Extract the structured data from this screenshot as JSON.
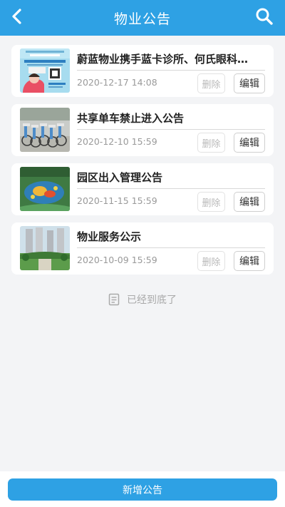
{
  "header": {
    "title": "物业公告",
    "back_icon": "chevron-left-icon",
    "search_icon": "search-icon"
  },
  "notices": [
    {
      "title": "蔚蓝物业携手蓝卡诊所、何氏眼科…",
      "date": "2020-12-17 14:08",
      "delete_label": "删除",
      "edit_label": "编辑"
    },
    {
      "title": "共享单车禁止进入公告",
      "date": "2020-12-10 15:59",
      "delete_label": "删除",
      "edit_label": "编辑"
    },
    {
      "title": "园区出入管理公告",
      "date": "2020-11-15 15:59",
      "delete_label": "删除",
      "edit_label": "编辑"
    },
    {
      "title": "物业服务公示",
      "date": "2020-10-09 15:59",
      "delete_label": "删除",
      "edit_label": "编辑"
    }
  ],
  "end_note": {
    "icon": "document-icon",
    "text": "已经到底了"
  },
  "footer": {
    "add_label": "新增公告"
  },
  "colors": {
    "accent": "#2ea1e4",
    "background": "#f3f4f6"
  }
}
